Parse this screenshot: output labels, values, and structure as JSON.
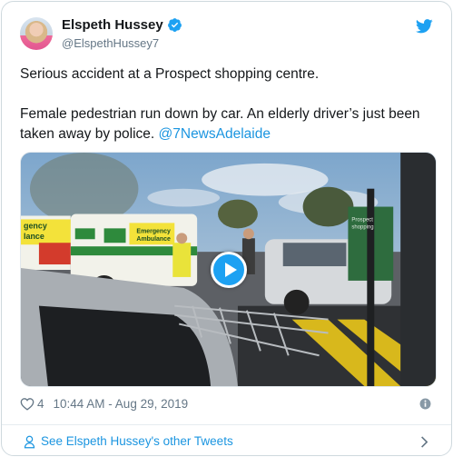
{
  "author": {
    "display_name": "Elspeth Hussey",
    "handle": "@ElspethHussey7",
    "verified": true,
    "avatar_icon": "avatar-photo"
  },
  "tweet": {
    "paragraph_1": "Serious accident at a Prospect shopping centre.",
    "paragraph_2_text": "Female pedestrian run down by car. An elderly driver’s just been taken away by police.",
    "paragraph_2_mention": "@7NewsAdelaide"
  },
  "media": {
    "type": "video",
    "play_icon": "play-icon",
    "ambulance_text_left": "gency\nlance",
    "ambulance_text_side": "Emergency\nAmbulance",
    "sign_text": "Prospect\nshopping"
  },
  "meta": {
    "like_count": "4",
    "timestamp": "10:44 AM - Aug 29, 2019"
  },
  "footer": {
    "other_tweets_label": "See Elspeth Hussey's other Tweets"
  },
  "colors": {
    "link": "#1b95e0",
    "twitter_blue": "#1da1f2",
    "secondary_text": "#657786",
    "border": "#cfd9de"
  }
}
